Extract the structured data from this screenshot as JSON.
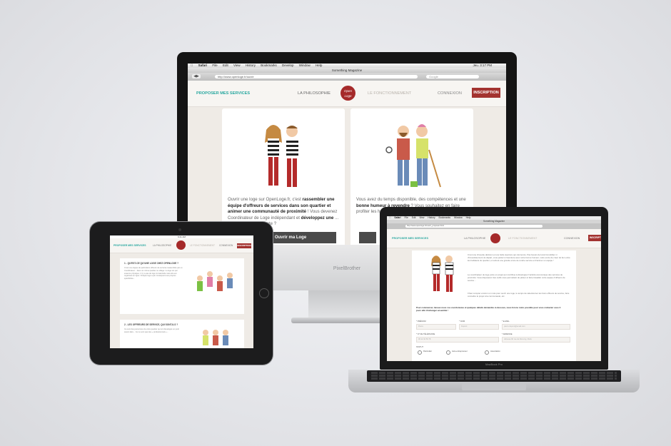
{
  "imac": {
    "brand": "PixelBrother",
    "menubar": [
      "Safari",
      "File",
      "Edit",
      "View",
      "History",
      "Bookmarks",
      "Develop",
      "Window",
      "Help"
    ],
    "clock": "Jeu. 3:17 PM",
    "window_title": "Something Magazine",
    "url": "http://www.openloge.fr/ouvrir",
    "search_placeholder": "Google",
    "nav": {
      "brand": "PROPOSER MES SERVICES",
      "link1": "LA PHILOSOPHIE",
      "logo": "Open Loge",
      "link2": "LE FONCTIONNEMENT",
      "link3": "CONNEXION",
      "cta": "INSCRIPTION"
    },
    "card1": {
      "text_a": "Ouvrir une loge sur OpenLoge.fr, c'est ",
      "text_b": "rassembler une équipe d'offreurs de services dans son quartier et animer une communauté de proximité",
      "text_c": " ! Vous devenez Coordinateur de Loge indépendant et ",
      "text_d": "développez une",
      "text_e": " ... locale. Celui vous tente ?",
      "button": "Ouvrir ma Loge"
    },
    "card2": {
      "text_a": "Vous avez du temps disponible, des compétences et une ",
      "text_b": "bonne humeur à revendre",
      "text_c": " ? Vous souhaitez en faire profiter les h... de votre qu... Dites-nous ..."
    }
  },
  "ipad": {
    "status": "9:41 AM",
    "nav": {
      "brand": "PROPOSER MES SERVICES",
      "link1": "LA PHILOSOPHIE",
      "link2": "LE FONCTIONNEMENT",
      "link3": "CONNEXION",
      "cta": "INSCRIPTION"
    },
    "section1_title": "1 - QU'EST-CE QU'UNE LOGE CHEZ OPENLOGE ?",
    "section1_text": "C'est une équipe de particuliers offreurs de services rassemblés par un Coordinateur... dans un même quartier ou village. La loge est par essence physique, il n'y a pas de loge immatérielle mais elle est organisée en ligne. Chaque loge a par conséquent ses propres spécificités...",
    "section2_title": "2 - LES OFFREURS DE SERVICE, QUI SONT-ILS ?",
    "section2_text": "Ce sont des personnes de votre quartier qui ont développé un petit savoir-faire... Ce ne sont pas des « professionnels »..."
  },
  "macbook": {
    "brand": "MacBook Pro",
    "menubar": [
      "Safari",
      "File",
      "Edit",
      "View",
      "History",
      "Bookmarks",
      "Window",
      "Help"
    ],
    "window_title": "Something Magazine",
    "url": "http://www.openloge.fr/ouvrir_proposer.html",
    "nav": {
      "brand": "PROPOSER MES SERVICES",
      "link1": "LA PHILOSOPHIE",
      "link2": "LE FONCTIONNEMENT",
      "link3": "CONNEXION",
      "cta": "INSCRIPTION"
    },
    "intro": "C'est une chouette décision et une belle aventure qui s'annonce. Pas besoin de local immobilier ni d'investissement de départ, vous partez à l'aventure avec votre bonne humeur, votre envie de créer du lien entre les habitants du quartier, et surtout une grande envie de rendre service et d'animer un équipe !",
    "intro2": "Le coordinateur de loge porte un projet qui contribue à développer l'activité économique des services de proximité. Vous disposerez des outils vous permettant de piloter et faire travailler votre équipe d'offreurs de service...",
    "intro3": "Il faut compter environ un mois pour ouvrir une loge, le temps de sélectionner les bons offreurs de service, faire connaître le projet à la communauté, etc.",
    "cta_text": "Pour commencer, laissez-nous vos coordonnées et quelques détails demandés ci-dessous, nous ferons notre possible pour vous contacter sous 3 jours afin d'échanger ensemble !",
    "form": {
      "prenom_label": "* PRÉNOM",
      "prenom_placeholder": "Pierre",
      "nom_label": "* NOM",
      "nom_placeholder": "Dupont",
      "email_label": "* E-MAIL",
      "email_placeholder": "pierre.dupont@email.com",
      "tel_label": "* N° DE TÉLÉPHONE",
      "tel_placeholder": "06 12 34 56 78",
      "adresse_label": "* ADRESSE",
      "adresse_placeholder": "Adresse 60 rue de Rouvroy, Paris",
      "statut_label": "STATUT",
      "radio1": "Particulier",
      "radio2": "Auto-entrepreneur",
      "radio3": "Association"
    }
  }
}
